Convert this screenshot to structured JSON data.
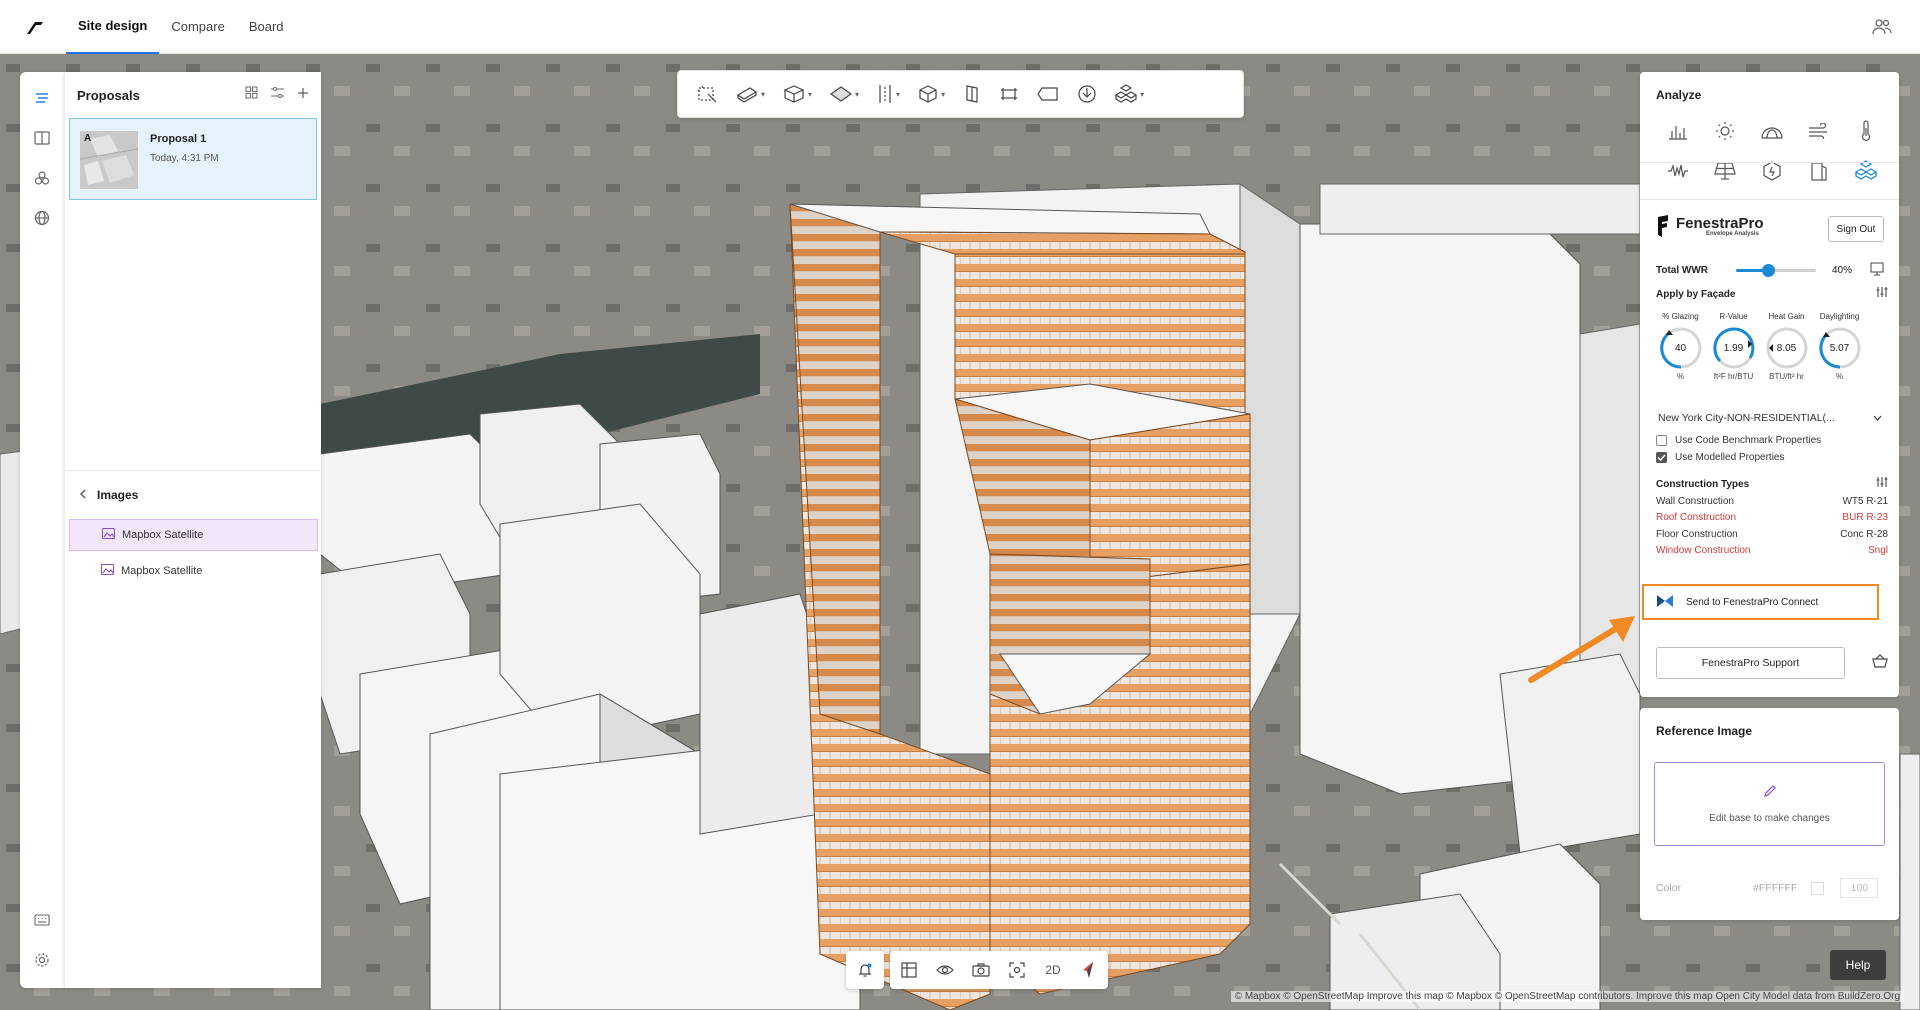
{
  "header": {
    "tabs": [
      {
        "label": "Site design"
      },
      {
        "label": "Compare"
      },
      {
        "label": "Board"
      }
    ]
  },
  "proposals": {
    "title": "Proposals",
    "items": [
      {
        "name": "Proposal 1",
        "time": "Today, 4:31 PM",
        "badge": "A"
      }
    ]
  },
  "images": {
    "title": "Images",
    "items": [
      {
        "label": "Mapbox Satellite"
      },
      {
        "label": "Mapbox Satellite"
      }
    ]
  },
  "bottom_toolbar": {
    "mode_label": "2D"
  },
  "analyze": {
    "title": "Analyze"
  },
  "fenestrapro": {
    "brand": "FenestraPro",
    "subtitle": "Envelope Analysis",
    "sign_out": "Sign Out",
    "total_wwr_label": "Total WWR",
    "total_wwr_value": "40%",
    "total_wwr_fraction": 0.4,
    "apply_by_facade": "Apply by Façade",
    "gauges": [
      {
        "title": "% Glazing",
        "value": "40",
        "unit": "%"
      },
      {
        "title": "R-Value",
        "value": "1.99",
        "unit": "ft²F hr/BTU"
      },
      {
        "title": "Heat Gain",
        "value": "8.05",
        "unit": "BTU/ft² hr"
      },
      {
        "title": "Daylighting",
        "value": "5.07",
        "unit": "%"
      }
    ],
    "benchmark_select": "New York City-NON-RESIDENTIAL(...",
    "use_code_benchmark": "Use Code Benchmark Properties",
    "use_modelled": "Use Modelled Properties",
    "construction_types_title": "Construction Types",
    "construction_types": [
      {
        "label": "Wall Construction",
        "value": "WT5 R-21",
        "alert": false
      },
      {
        "label": "Roof Construction",
        "value": "BUR R-23",
        "alert": true
      },
      {
        "label": "Floor Construction",
        "value": "Conc R-28",
        "alert": false
      },
      {
        "label": "Window Construction",
        "value": "Sngl",
        "alert": true
      }
    ],
    "send_button": "Send to FenestraPro Connect",
    "support_button": "FenestraPro Support",
    "colors": {
      "alert": "#d63a3a",
      "accent": "#1a8ad4",
      "highlight": "#f08a24"
    }
  },
  "reference_image": {
    "title": "Reference Image",
    "edit_hint": "Edit base to make changes",
    "color_label": "Color",
    "color_value": "#FFFFFF",
    "opacity_value": "100"
  },
  "help_label": "Help",
  "attribution": "© Mapbox © OpenStreetMap Improve this map © Mapbox © OpenStreetMap contributors. Improve this map Open City Model data from BuildZero.Org"
}
